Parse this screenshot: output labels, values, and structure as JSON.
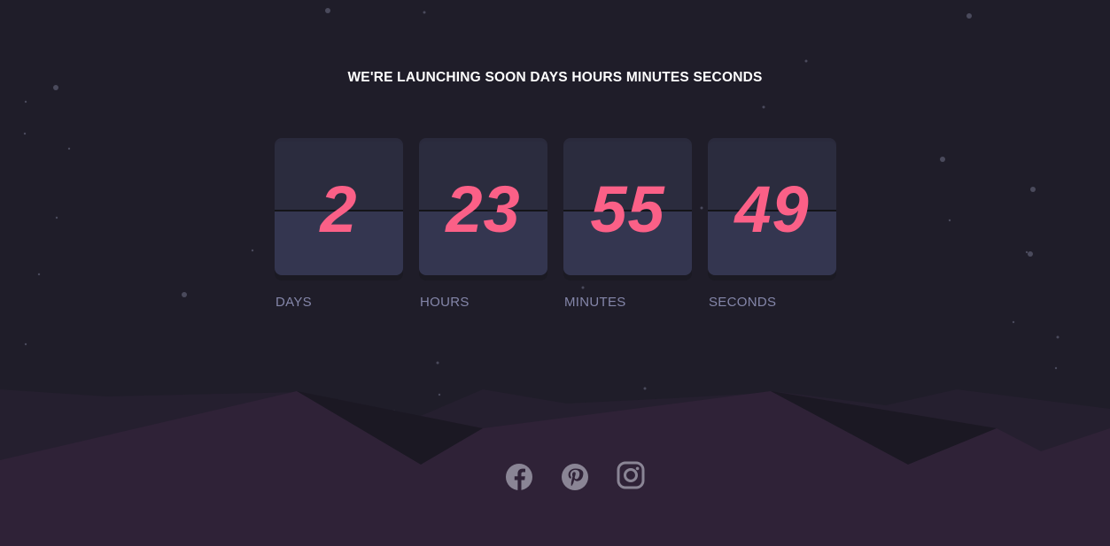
{
  "headline": "WE'RE LAUNCHING SOON DAYS HOURS MINUTES SECONDS",
  "countdown": [
    {
      "value": "2",
      "label": "DAYS"
    },
    {
      "value": "23",
      "label": "HOURS"
    },
    {
      "value": "55",
      "label": "MINUTES"
    },
    {
      "value": "49",
      "label": "SECONDS"
    }
  ],
  "colors": {
    "background": "#1f1d29",
    "digit": "#fb6087",
    "label": "#8486a9",
    "hills": "#2f2237",
    "icon": "#8a8595"
  },
  "socials": [
    "facebook-icon",
    "pinterest-icon",
    "instagram-icon"
  ]
}
